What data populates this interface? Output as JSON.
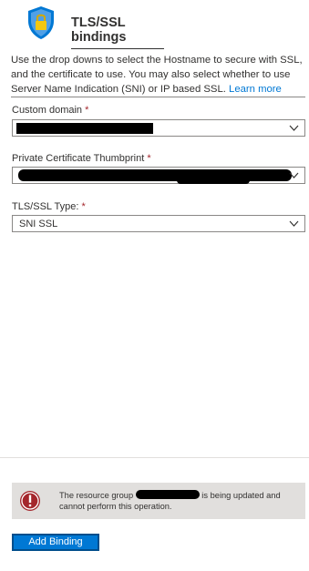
{
  "header": {
    "title": "TLS/SSL bindings",
    "icon": "shield-lock-icon"
  },
  "description": {
    "text": "Use the drop downs to select the Hostname to secure with SSL, and the certificate to use. You may also select whether to use Server Name Indication (SNI) or IP based SSL. ",
    "link": "Learn more"
  },
  "fields": {
    "custom_domain": {
      "label": "Custom domain",
      "required": "*",
      "value": ""
    },
    "thumbprint": {
      "label": "Private Certificate Thumbprint",
      "required": "*",
      "value": ""
    },
    "ssl_type": {
      "label": "TLS/SSL Type:",
      "required": "*",
      "value": "SNI SSL"
    }
  },
  "error_banner": {
    "text_before": "The resource group ",
    "text_after": " is being updated and cannot perform this operation.",
    "icon": "error-icon"
  },
  "actions": {
    "add_binding": "Add Binding"
  },
  "colors": {
    "accent": "#0078d4",
    "required": "#a4262c",
    "error": "#a4262c",
    "banner_bg": "#e1dfdd"
  }
}
